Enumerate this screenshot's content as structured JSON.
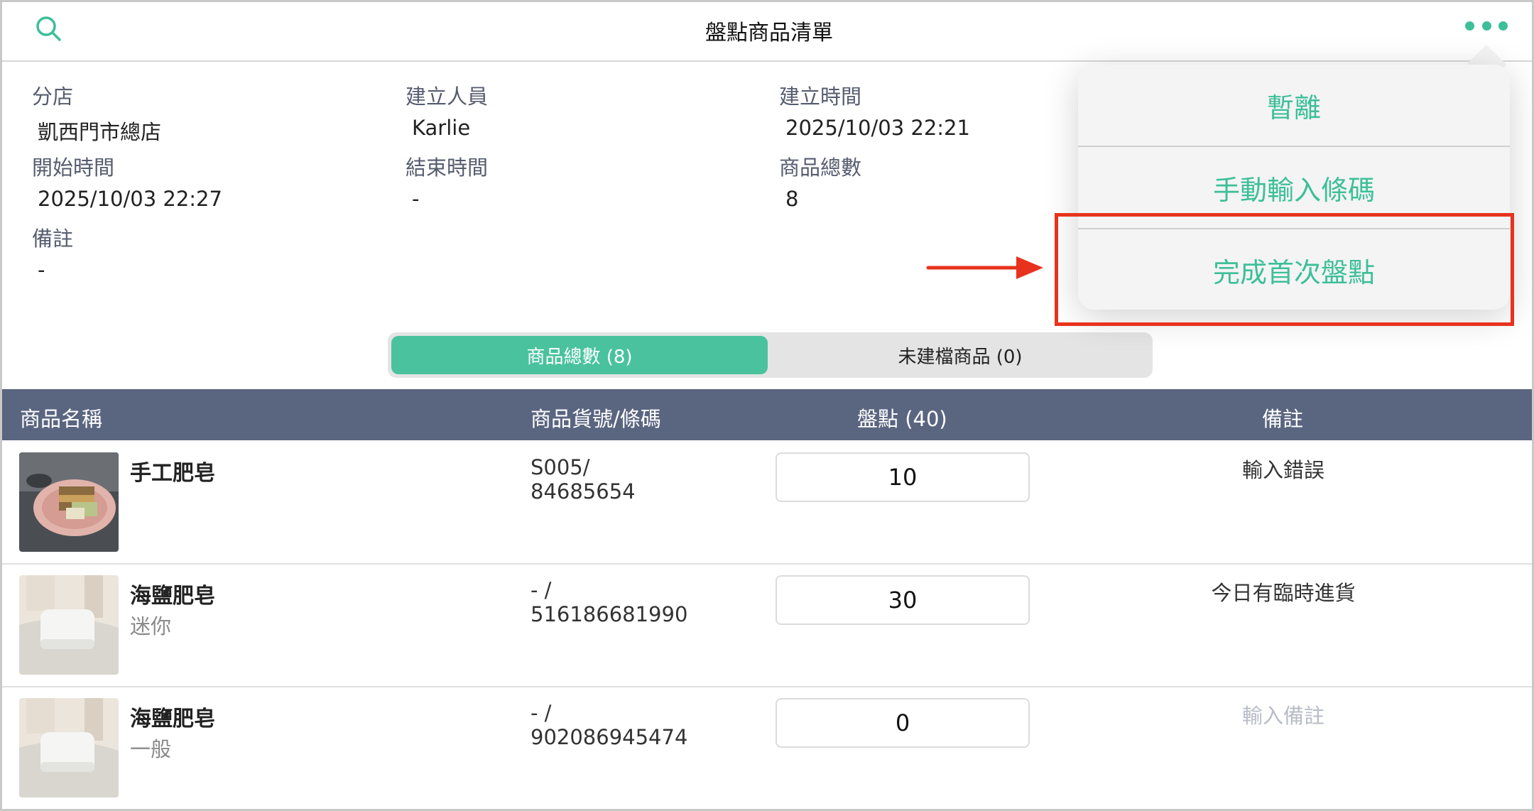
{
  "header": {
    "title": "盤點商品清單"
  },
  "info": {
    "branch_label": "分店",
    "branch_value": "凱西門市總店",
    "creator_label": "建立人員",
    "creator_value": "Karlie",
    "created_time_label": "建立時間",
    "created_time_value": "2025/10/03 22:21",
    "start_label": "開始時間",
    "start_value": "2025/10/03 22:27",
    "end_label": "結束時間",
    "end_value": "-",
    "total_label": "商品總數",
    "total_value": "8",
    "note_label": "備註",
    "note_value": "-"
  },
  "tabs": [
    {
      "label": "商品總數 (8)",
      "active": true
    },
    {
      "label": "未建檔商品 (0)",
      "active": false
    }
  ],
  "table": {
    "columns": [
      "商品名稱",
      "商品貨號/條碼",
      "盤點 (40)",
      "備註"
    ],
    "rows": [
      {
        "name": "手工肥皂",
        "variant": "",
        "code_line1": "S005/",
        "code_line2": "84685654",
        "qty": "10",
        "remark": "輸入錯誤",
        "remark_is_placeholder": false
      },
      {
        "name": "海鹽肥皂",
        "variant": "迷你",
        "code_line1": " - /",
        "code_line2": "516186681990",
        "qty": "30",
        "remark": "今日有臨時進貨",
        "remark_is_placeholder": false
      },
      {
        "name": "海鹽肥皂",
        "variant": "一般",
        "code_line1": " - /",
        "code_line2": "902086945474",
        "qty": "0",
        "remark": "輸入備註",
        "remark_is_placeholder": true
      }
    ]
  },
  "menu": {
    "items": [
      "暫離",
      "手動輸入條碼",
      "完成首次盤點"
    ]
  },
  "colors": {
    "accent": "#3dbf99",
    "tab_active": "#49c29d",
    "table_header": "#5a6580",
    "highlight": "#e8321e"
  },
  "icons": {
    "search": "search-icon",
    "more": "more-horizontal-icon"
  }
}
